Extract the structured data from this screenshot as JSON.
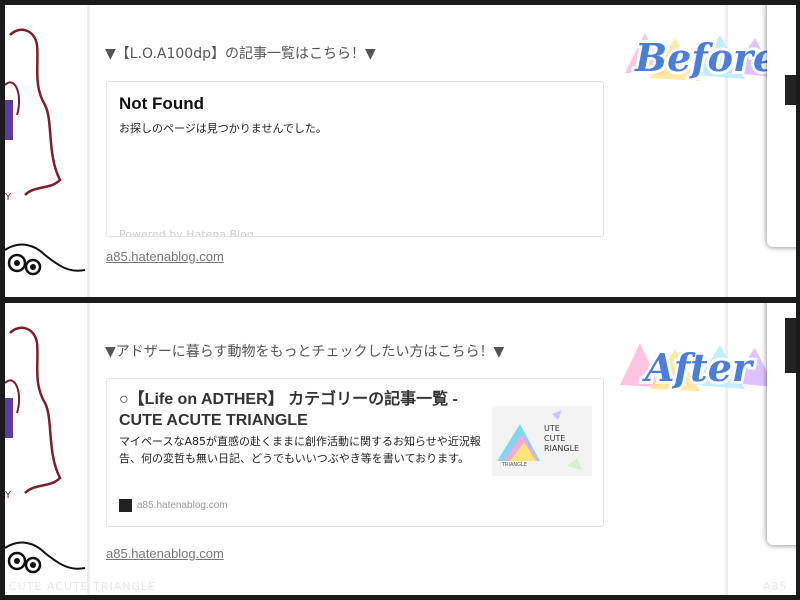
{
  "before": {
    "badge": "Before",
    "heading": "▼【L.O.A100dp】の記事一覧はこちら！▼",
    "embed": {
      "title": "Not Found",
      "description": "お探しのページは見つかりませんでした。",
      "footer_fade": "Powered by Hatena Blog"
    },
    "link": "a85.hatenablog.com"
  },
  "after": {
    "badge": "After",
    "heading": "▼アドザーに暮らす動物をもっとチェックしたい方はこちら！▼",
    "embed": {
      "title": "○【Life on ADTHER】 カテゴリーの記事一覧 - CUTE ACUTE TRIANGLE",
      "description": "マイペースなA85が直感の赴くままに創作活動に関するお知らせや近況報告、何の変哲も無い日記、どうでもいいつぶやき等を書いております。",
      "site": "a85.hatenablog.com",
      "thumb_lines": [
        "UTE",
        "CUTE",
        "RIANGLE"
      ],
      "thumb_caption": "TRIANGLE"
    },
    "link": "a85.hatenablog.com"
  },
  "footer": {
    "left": "CUTE ACUTE TRIANGLE",
    "right": "A85"
  },
  "colors": {
    "badge_fill": "#4a7de0",
    "link": "#777777",
    "heading": "#555555"
  }
}
